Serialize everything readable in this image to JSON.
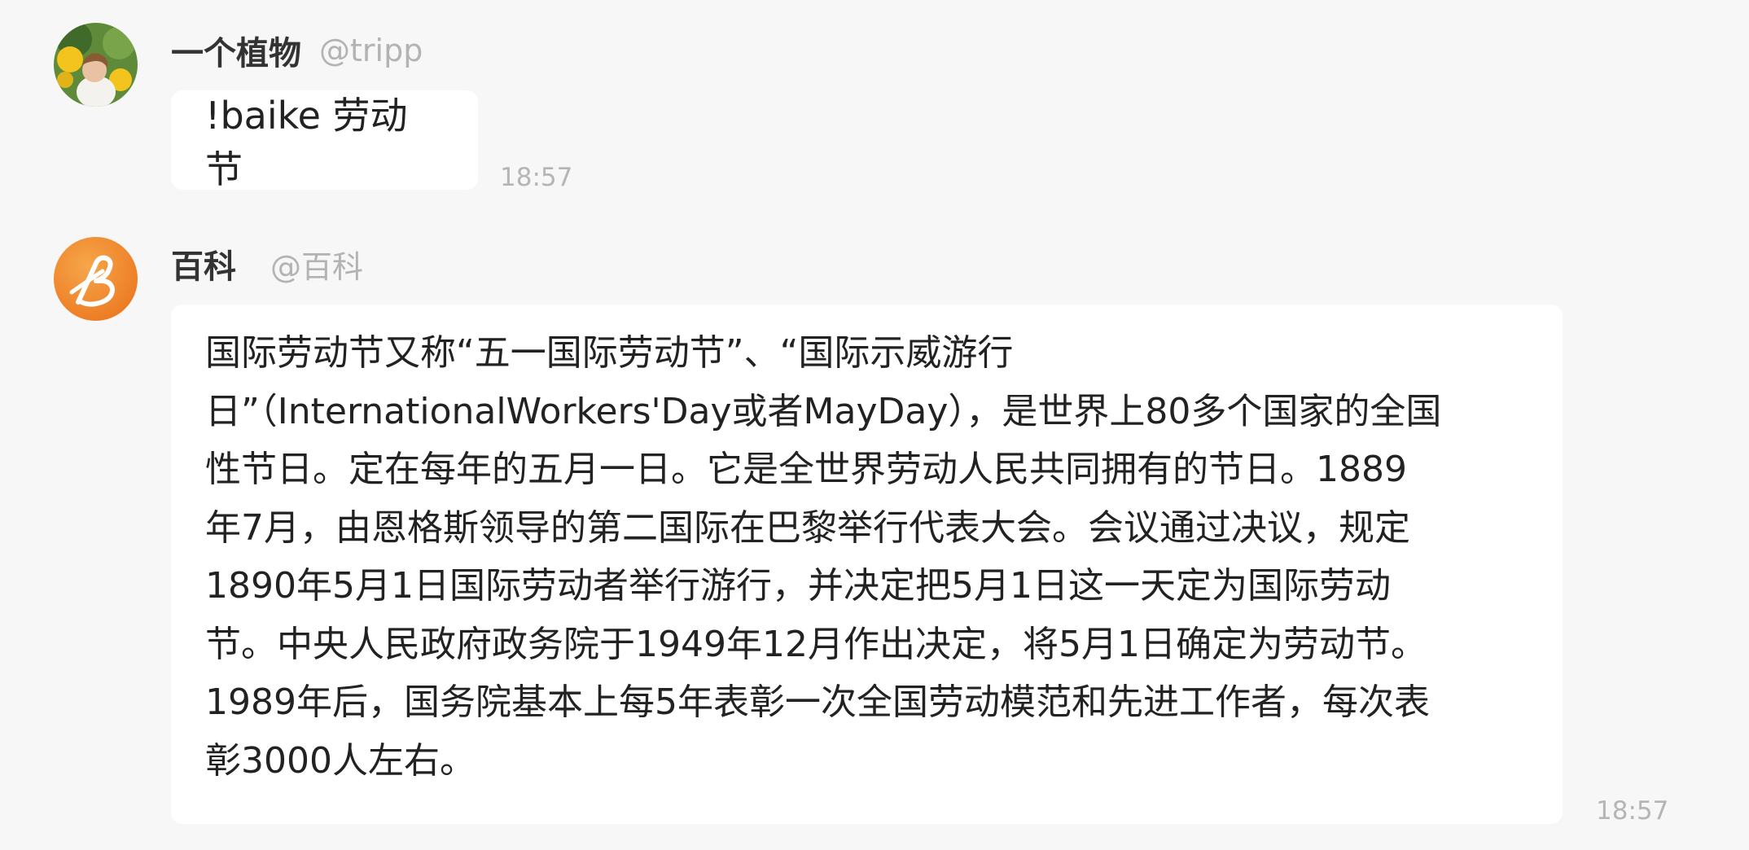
{
  "messages": [
    {
      "sender": "一个植物",
      "handle": "@tripp",
      "text": "!baike 劳动节",
      "time": "18:57"
    },
    {
      "sender": "百科",
      "handle": "@百科",
      "lines": [
        "国际劳动节又称“五一国际劳动节”、“国际示威游行",
        "日”（InternationalWorkers'Day或者MayDay），是世界上80多个国家的全国",
        "性节日。定在每年的五月一日。它是全世界劳动人民共同拥有的节日。1889",
        "年7月，由恩格斯领导的第二国际在巴黎举行代表大会。会议通过决议，规定",
        "1890年5月1日国际劳动者举行游行，并决定把5月1日这一天定为国际劳动",
        "节。中央人民政府政务院于1949年12月作出决定，将5月1日确定为劳动节。",
        "1989年后，国务院基本上每5年表彰一次全国劳动模范和先进工作者，每次表",
        "彰3000人左右。"
      ],
      "time": "18:57"
    }
  ],
  "colors": {
    "background": "#f7f7f7",
    "bubble": "#ffffff",
    "muted": "#b3b3b3",
    "bot_avatar": "#f08a2a"
  },
  "icons": {
    "user_avatar": "user-avatar-photo",
    "bot_avatar": "baike-logo-icon"
  }
}
